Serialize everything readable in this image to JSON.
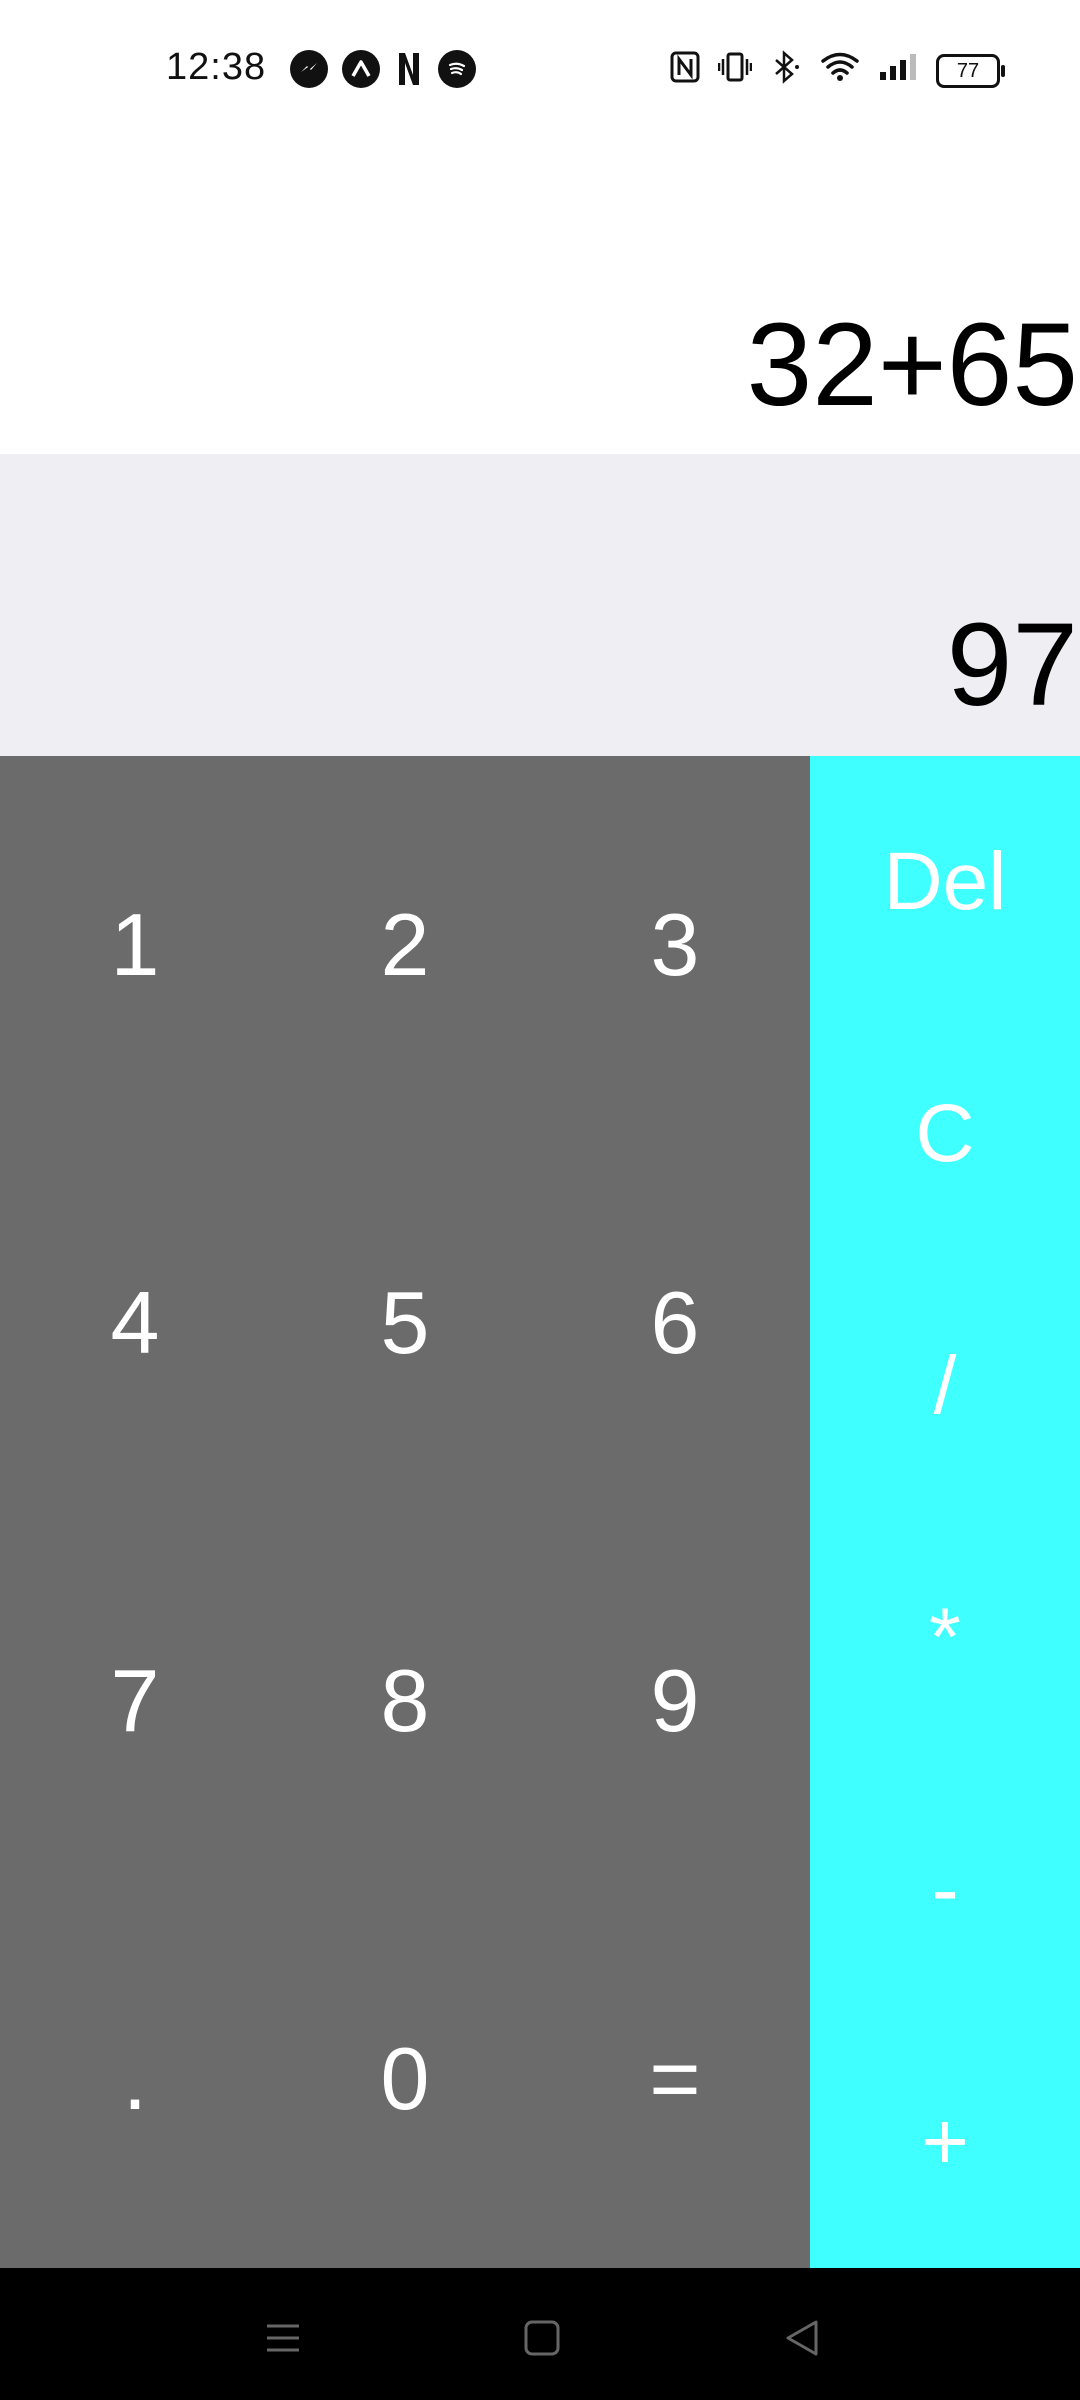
{
  "status_bar": {
    "time": "12:38",
    "battery_level": "77",
    "notification_icons": [
      "messenger-icon",
      "app-a-icon",
      "netflix-icon",
      "spotify-icon"
    ],
    "system_icons": [
      "nfc-icon",
      "vibrate-icon",
      "bluetooth-icon",
      "wifi-icon",
      "signal-icon",
      "battery-icon"
    ]
  },
  "display": {
    "expression": "32+65",
    "result": "97"
  },
  "keypad": {
    "keys": [
      "1",
      "2",
      "3",
      "4",
      "5",
      "6",
      "7",
      "8",
      "9",
      ".",
      "0",
      "="
    ]
  },
  "operators": {
    "keys": [
      "Del",
      "C",
      "/",
      "*",
      "-",
      "+"
    ]
  },
  "colors": {
    "keypad_bg": "#6b6b6b",
    "operator_bg": "#3fffff",
    "result_bg": "#efeff3"
  }
}
